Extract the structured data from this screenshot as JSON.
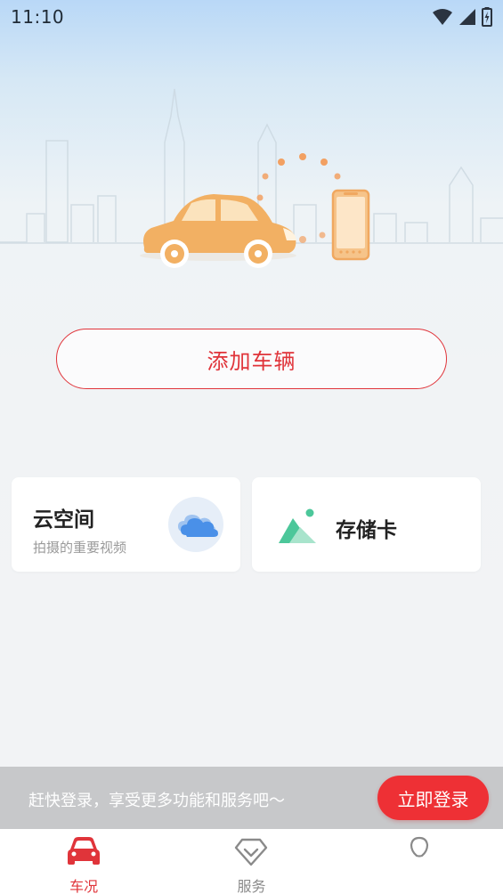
{
  "status_bar": {
    "time": "11:10"
  },
  "main": {
    "add_vehicle_label": "添加车辆"
  },
  "cards": {
    "cloud": {
      "title": "云空间",
      "subtitle": "拍摄的重要视频"
    },
    "sd_card": {
      "title": "存储卡"
    }
  },
  "login_bar": {
    "text": "赶快登录，享受更多功能和服务吧～",
    "button_label": "立即登录"
  },
  "tabs": [
    {
      "label": "车况",
      "icon": "car-icon",
      "active": true,
      "color": "#e0343a"
    },
    {
      "label": "服务",
      "icon": "diamond-icon",
      "active": false,
      "color": "#8a8a8a"
    },
    {
      "label": "",
      "icon": "profile-icon",
      "active": false,
      "color": "#8a8a8a"
    }
  ],
  "colors": {
    "accent": "#e0343a",
    "car": "#f2b063",
    "cloud": "#4a90e8",
    "sd": "#4cc79a"
  }
}
